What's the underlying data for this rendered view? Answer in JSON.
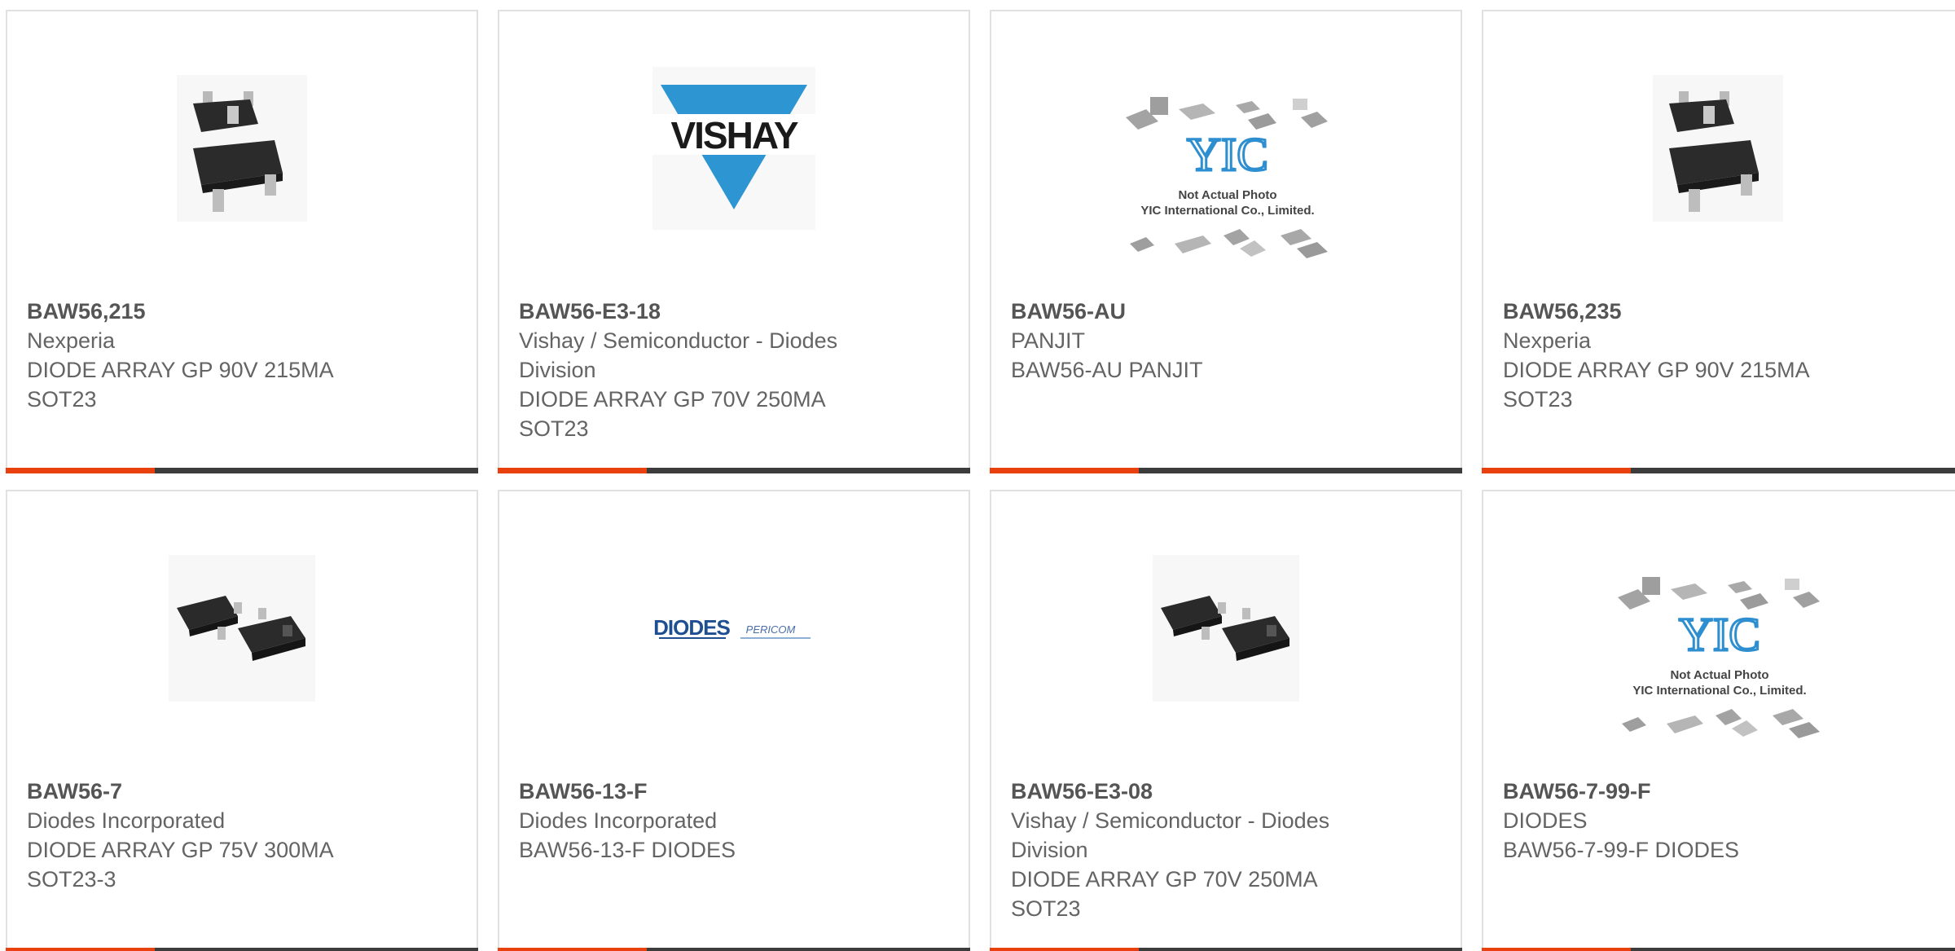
{
  "products": [
    {
      "part": "BAW56,215",
      "maker": "Nexperia",
      "desc": "DIODE ARRAY GP 90V 215MA SOT23",
      "image": "sot23-package-photo"
    },
    {
      "part": "BAW56-E3-18",
      "maker": "Vishay / Semiconductor - Diodes Division",
      "desc": "DIODE ARRAY GP 70V 250MA SOT23",
      "image": "vishay-logo"
    },
    {
      "part": "BAW56-AU",
      "maker": "PANJIT",
      "desc": "BAW56-AU PANJIT",
      "image": "yic-placeholder",
      "placeholder_lines": [
        "Not Actual Photo",
        "YIC International Co., Limited."
      ],
      "logo_text": "YIC"
    },
    {
      "part": "BAW56,235",
      "maker": "Nexperia",
      "desc": "DIODE ARRAY GP 90V 215MA SOT23",
      "image": "sot23-package-photo"
    },
    {
      "part": "BAW56-7",
      "maker": "Diodes Incorporated",
      "desc": "DIODE ARRAY GP 75V 300MA SOT23-3",
      "image": "sot23-pair-photo"
    },
    {
      "part": "BAW56-13-F",
      "maker": "Diodes Incorporated",
      "desc": "BAW56-13-F DIODES",
      "image": "diodes-pericom-logo",
      "logo_text": "DIODES",
      "logo_text2": "PERICOM"
    },
    {
      "part": "BAW56-E3-08",
      "maker": "Vishay / Semiconductor - Diodes Division",
      "desc": "DIODE ARRAY GP 70V 250MA SOT23",
      "image": "sot23-pair-photo"
    },
    {
      "part": "BAW56-7-99-F",
      "maker": "DIODES",
      "desc": "BAW56-7-99-F DIODES",
      "image": "yic-placeholder",
      "placeholder_lines": [
        "Not Actual Photo",
        "YIC International Co., Limited."
      ],
      "logo_text": "YIC"
    }
  ],
  "vishay_logo_text": "VISHAY",
  "colors": {
    "accent": "#e8410e",
    "bar": "#3c3c3c",
    "text": "#646464",
    "border": "#e1e1e1",
    "vishay_blue": "#2e95d3"
  }
}
